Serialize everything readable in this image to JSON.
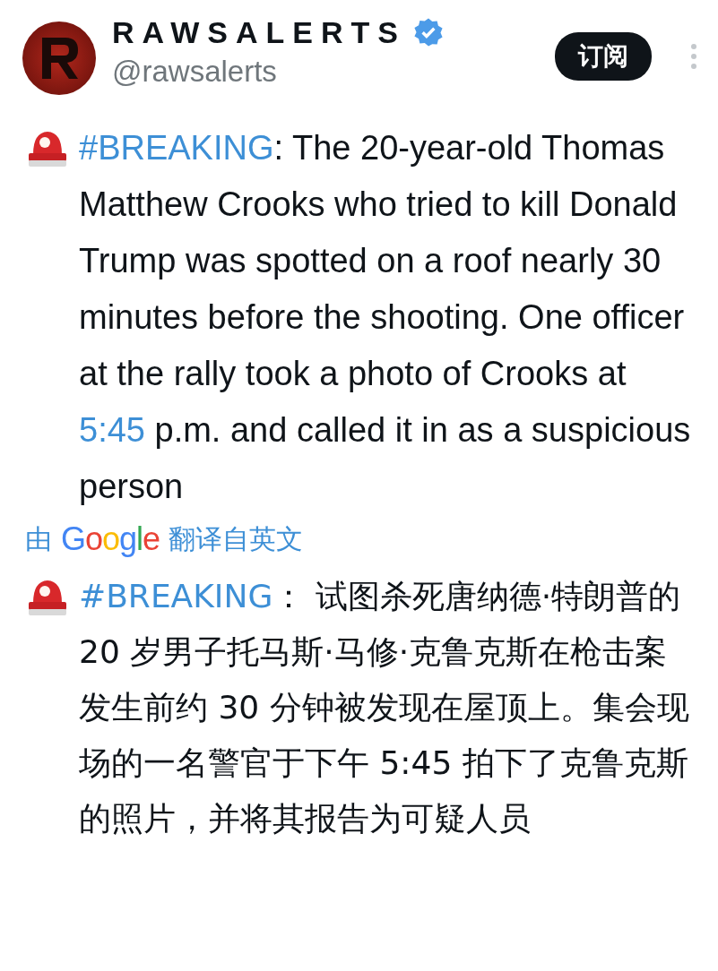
{
  "author": {
    "name": "RAWSALERTS",
    "verified": true,
    "handle": "@rawsalerts"
  },
  "subscribe_button": "订阅",
  "original_text": [
    {
      "kind": "link",
      "text": "#BREAKING"
    },
    {
      "kind": "plain",
      "text": ": The 20-year-old Thomas Matthew Crooks who tried to kill Donald Trump was spotted on a roof nearly 30 minutes before the shooting. One officer at the rally took a photo of Crooks at "
    },
    {
      "kind": "link",
      "text": "5:45"
    },
    {
      "kind": "plain",
      "text": " p.m. and called it in as a suspicious person"
    }
  ],
  "translation_note": {
    "prefix": "由",
    "provider": "Google",
    "suffix": "翻译自英文"
  },
  "translated_text": [
    {
      "kind": "link",
      "text": "#BREAKING"
    },
    {
      "kind": "plain",
      "text": "： 试图杀死唐纳德·特朗普的 20 岁男子托马斯·马修·克鲁克斯在枪击案发生前约 30 分钟被发现在屋顶上。集会现场的一名警官于下午 5:45 拍下了克鲁克斯的照片，并将其报告为可疑人员"
    }
  ]
}
